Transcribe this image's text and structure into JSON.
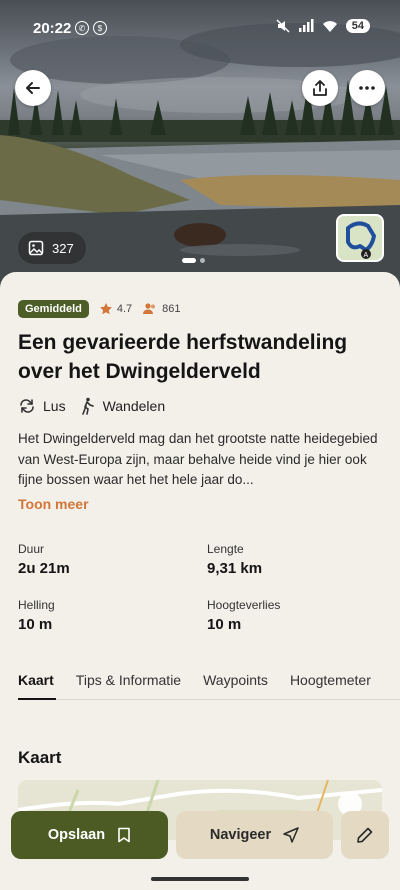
{
  "status_bar": {
    "time": "20:22",
    "battery": "54"
  },
  "hero": {
    "photo_count": "327",
    "icons": {
      "back": "arrow-left-icon",
      "share": "share-icon",
      "more": "more-dots-icon",
      "photos": "image-icon"
    }
  },
  "route": {
    "difficulty": "Gemiddeld",
    "rating": "4.7",
    "reviews": "861",
    "title": "Een gevarieerde herfstwandeling over het Dwingelderveld",
    "type": "Lus",
    "activity": "Wandelen",
    "description": "Het Dwingelderveld mag dan het grootste natte heidegebied van West-Europa zijn, maar behalve heide vind je hier ook fijne bossen waar het het hele jaar do...",
    "more_label": "Toon meer"
  },
  "stats": [
    {
      "label": "Duur",
      "value": "2u 21m"
    },
    {
      "label": "Lengte",
      "value": "9,31 km"
    },
    {
      "label": "Helling",
      "value": "10 m"
    },
    {
      "label": "Hoogteverlies",
      "value": "10 m"
    }
  ],
  "tabs": [
    "Kaart",
    "Tips & Informatie",
    "Waypoints",
    "Hoogtemeter"
  ],
  "section_title": "Kaart",
  "actions": {
    "save": "Opslaan",
    "navigate": "Navigeer"
  },
  "colors": {
    "primary": "#4b5b23",
    "accent": "#d2763a",
    "secondary": "#e4dac4",
    "background": "#f3f0ea"
  }
}
